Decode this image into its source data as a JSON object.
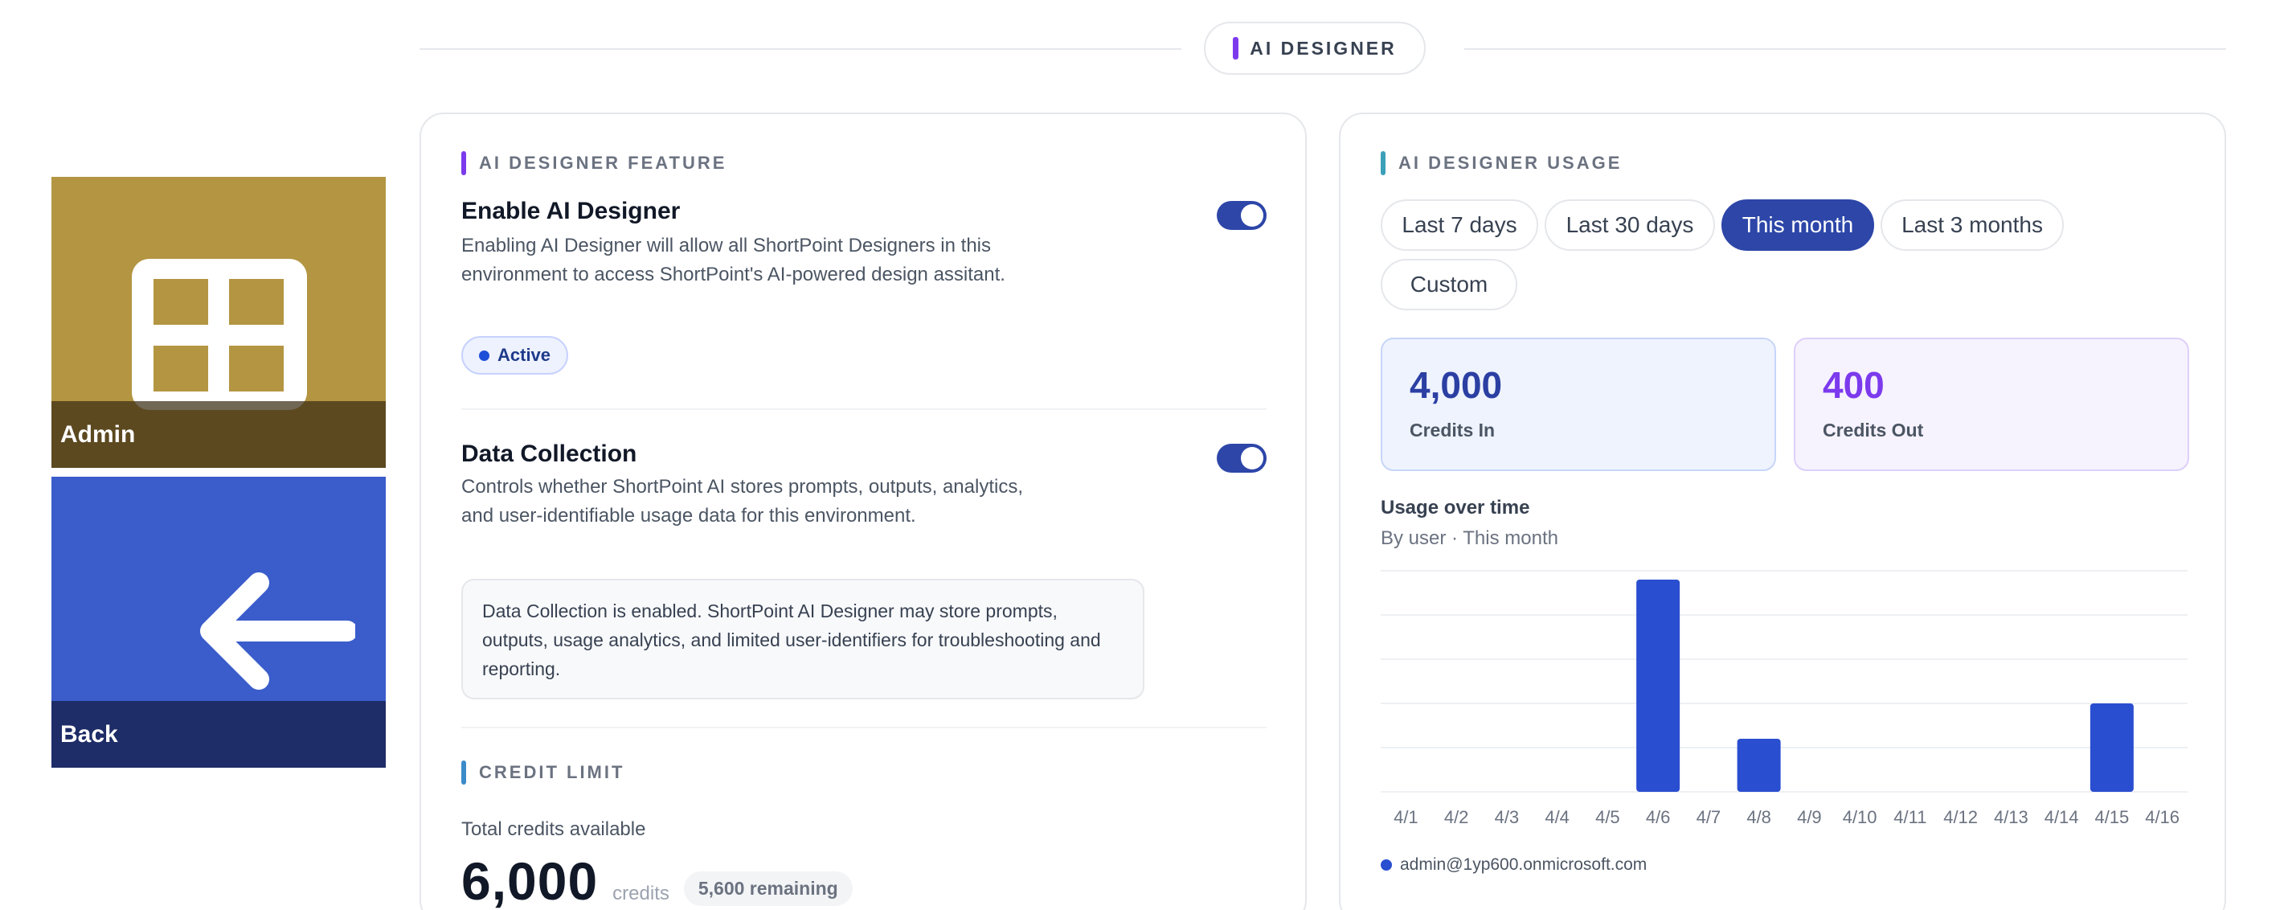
{
  "tiles": {
    "admin": {
      "label": "Admin",
      "color": "#b39542",
      "icon": "grid-icon"
    },
    "back": {
      "label": "Back",
      "color": "#3a5dcb",
      "icon": "arrow-left-icon"
    }
  },
  "header": {
    "title": "AI DESIGNER",
    "accent": "#7c3aed"
  },
  "feature_card": {
    "section_label": "AI DESIGNER FEATURE",
    "enable": {
      "title": "Enable AI Designer",
      "description": "Enabling AI Designer will allow all ShortPoint Designers in this environment to access ShortPoint's AI-powered design assitant.",
      "enabled": true,
      "status": "Active"
    },
    "data_collection": {
      "title": "Data Collection",
      "description": "Controls whether ShortPoint AI stores prompts, outputs, analytics, and user-identifiable usage data for this environment.",
      "enabled": true,
      "notice": "Data Collection is enabled. ShortPoint AI Designer may store prompts, outputs, usage analytics, and limited user-identifiers for troubleshooting and reporting."
    },
    "credit_limit": {
      "section_label": "CREDIT LIMIT",
      "subtitle": "Total credits available",
      "total": "6,000",
      "unit": "credits",
      "remaining": "5,600 remaining"
    }
  },
  "usage_card": {
    "section_label": "AI DESIGNER USAGE",
    "ranges": [
      "Last 7 days",
      "Last 30 days",
      "This month",
      "Last 3 months",
      "Custom"
    ],
    "selected_range": "This month",
    "credits_in": {
      "value": "4,000",
      "label": "Credits In"
    },
    "credits_out": {
      "value": "400",
      "label": "Credits Out"
    },
    "chart_title": "Usage over time",
    "chart_subtitle": "By user · This month",
    "legend_user": "admin@1yp600.onmicrosoft.com"
  },
  "chart_data": {
    "type": "bar",
    "categories": [
      "4/1",
      "4/2",
      "4/3",
      "4/4",
      "4/5",
      "4/6",
      "4/7",
      "4/8",
      "4/9",
      "4/10",
      "4/11",
      "4/12",
      "4/13",
      "4/14",
      "4/15",
      "4/16"
    ],
    "series": [
      {
        "name": "admin@1yp600.onmicrosoft.com",
        "color": "#2a4ed0",
        "values": [
          0,
          0,
          0,
          0,
          0,
          240,
          0,
          60,
          0,
          0,
          0,
          0,
          0,
          0,
          100,
          0
        ]
      }
    ],
    "ylim": [
      0,
      250
    ],
    "grid": true,
    "legend": "bottom-left"
  }
}
